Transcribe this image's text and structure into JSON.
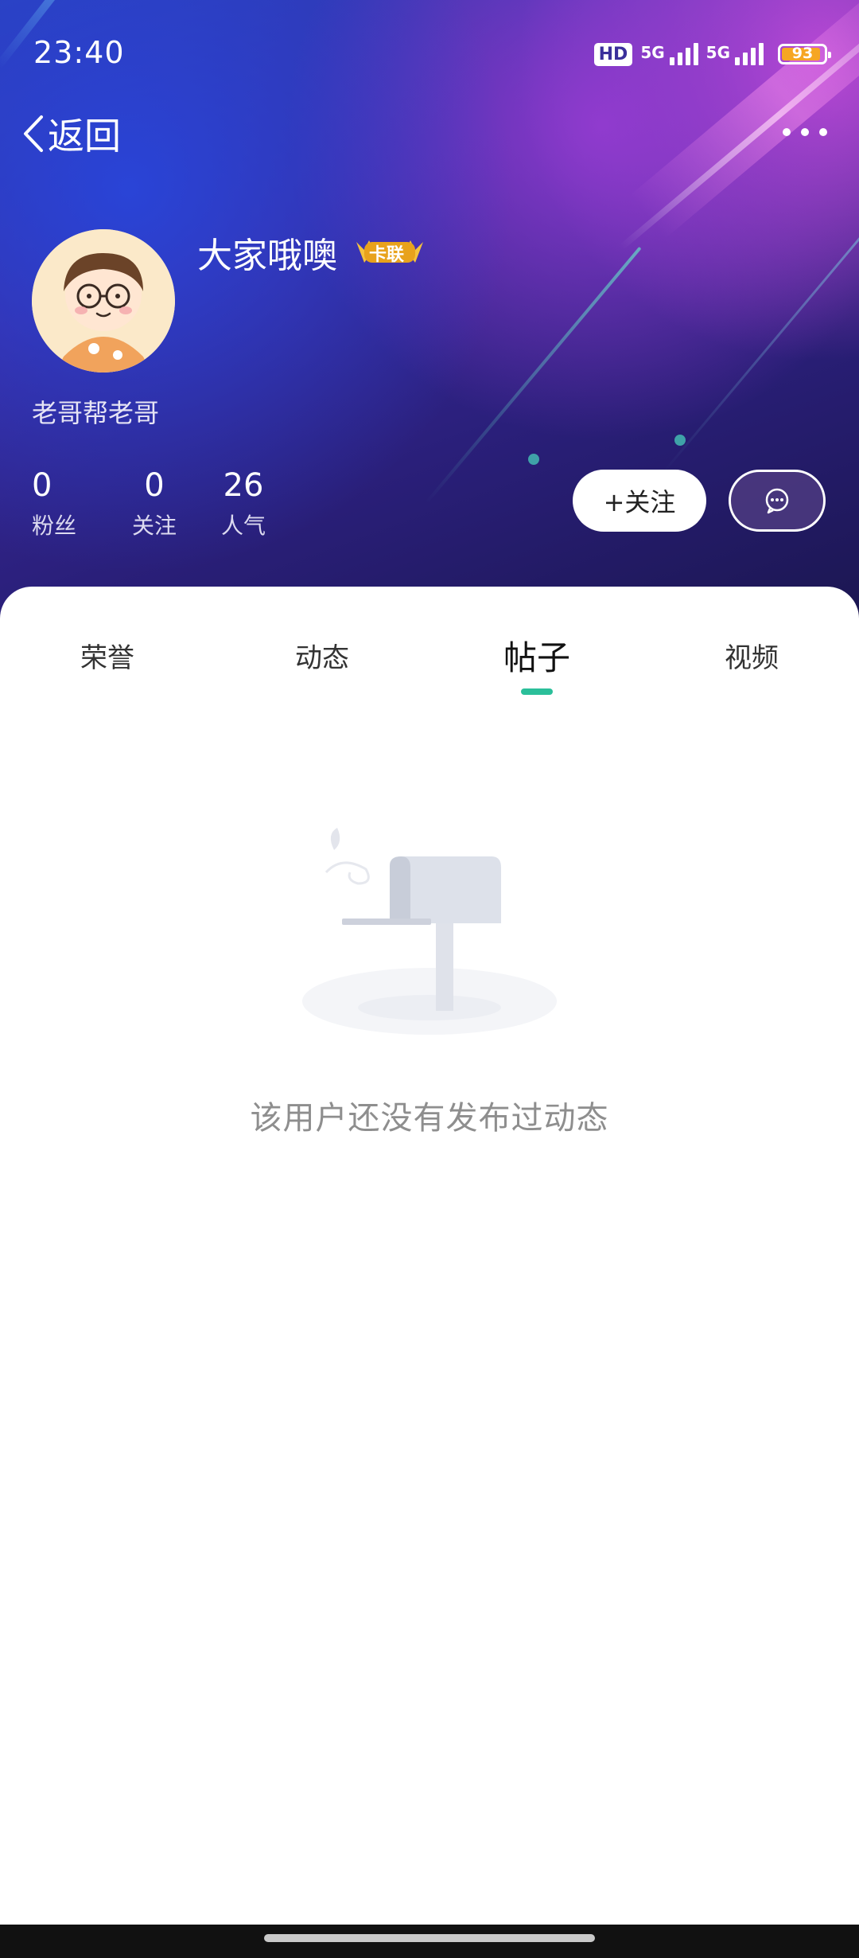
{
  "status_bar": {
    "time": "23:40",
    "hd_label": "HD",
    "sim1_label": "5G",
    "sim2_label": "5G",
    "battery_level": "93",
    "battery_fraction": 0.93,
    "battery_color": "#f6a623"
  },
  "nav": {
    "back_label": "返回",
    "more_icon": "more-dots-icon"
  },
  "profile": {
    "username": "大家哦噢",
    "badge": "卡联",
    "signature": "老哥帮老哥",
    "stats": [
      {
        "value": "0",
        "label": "粉丝"
      },
      {
        "value": "0",
        "label": "关注"
      },
      {
        "value": "26",
        "label": "人气"
      }
    ],
    "follow_label": "+关注",
    "message_icon": "chat-bubble-icon"
  },
  "tabs": [
    {
      "label": "荣誉",
      "active": false
    },
    {
      "label": "动态",
      "active": false
    },
    {
      "label": "帖子",
      "active": true
    },
    {
      "label": "视频",
      "active": false
    }
  ],
  "accent_color": "#2bbf9a",
  "empty_state": {
    "icon": "mailbox-icon",
    "message": "该用户还没有发布过动态"
  }
}
